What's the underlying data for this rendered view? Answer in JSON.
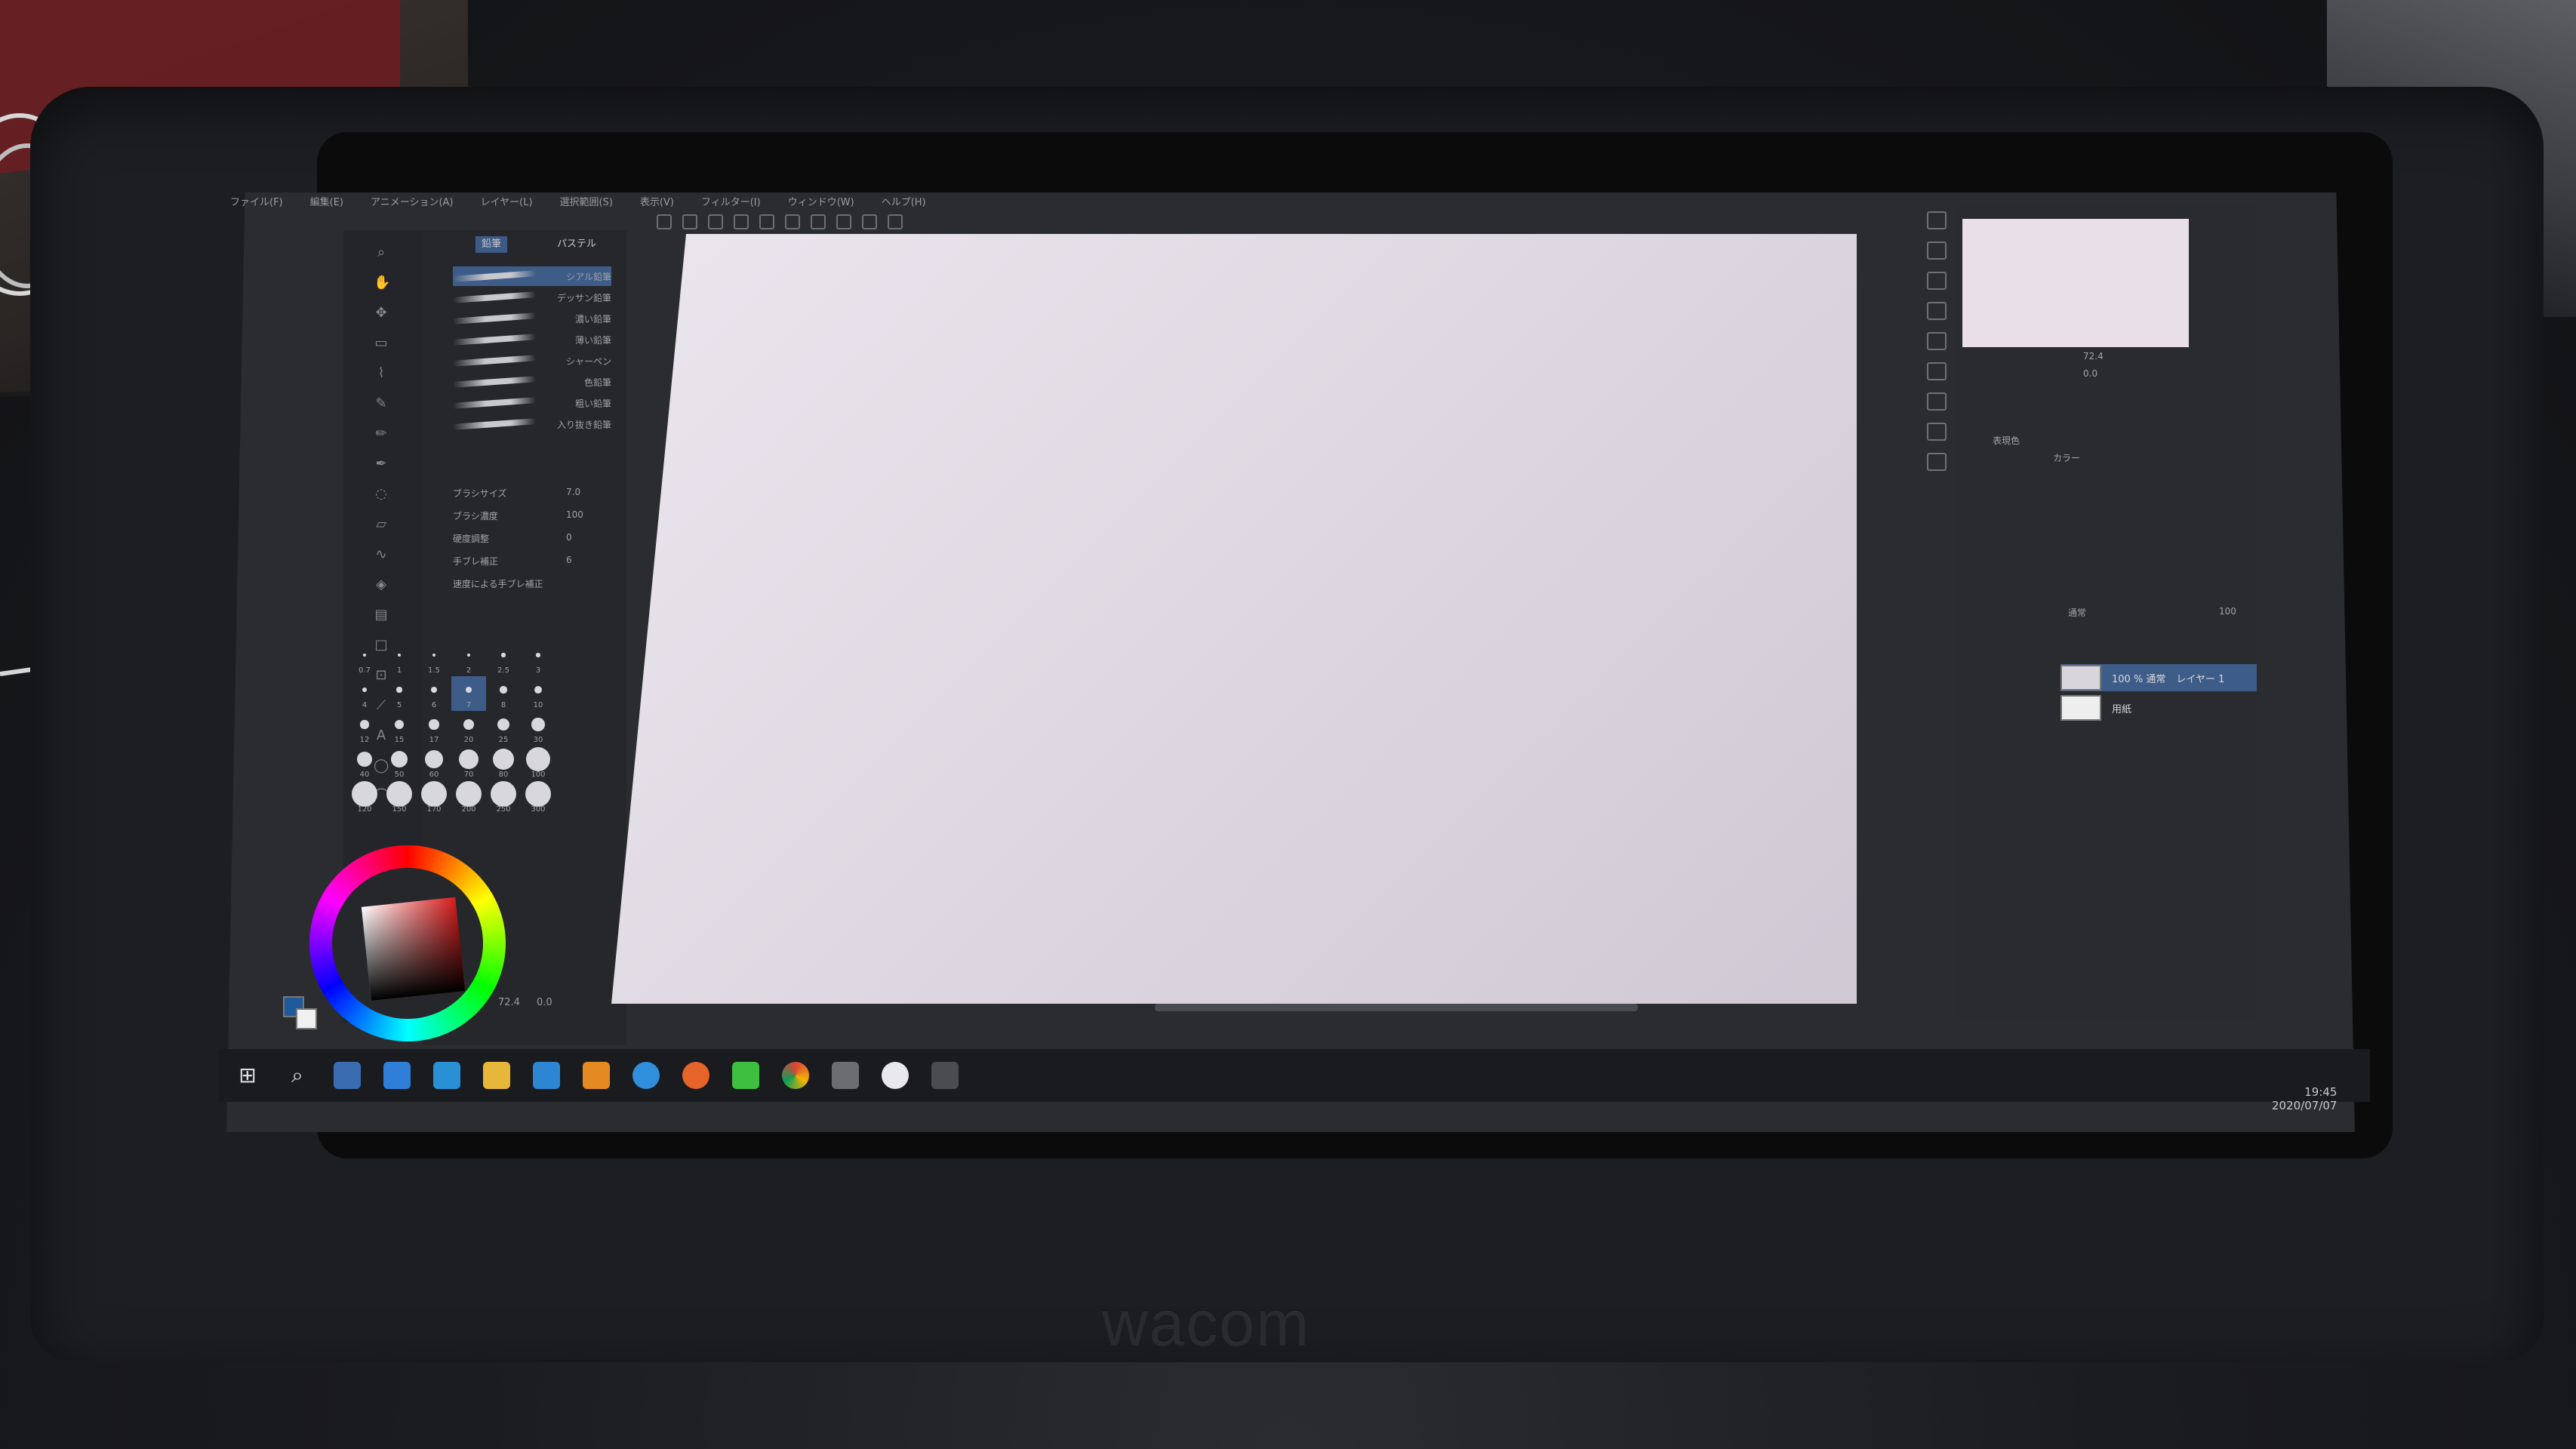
{
  "app": {
    "menu": [
      "ファイル(F)",
      "編集(E)",
      "アニメーション(A)",
      "レイヤー(L)",
      "選択範囲(S)",
      "表示(V)",
      "フィルター(I)",
      "ウィンドウ(W)",
      "ヘルプ(H)"
    ]
  },
  "subtool": {
    "tabs": [
      "鉛筆",
      "パステル"
    ],
    "brushes": [
      "シアル鉛筆",
      "デッサン鉛筆",
      "濃い鉛筆",
      "薄い鉛筆",
      "シャーペン",
      "色鉛筆",
      "粗い鉛筆",
      "入り抜き鉛筆"
    ],
    "props": {
      "brush_size_label": "ブラシサイズ",
      "brush_size_value": "7.0",
      "density_label": "ブラシ濃度",
      "density_value": "100",
      "hardness_label": "硬度調整",
      "hardness_value": "0",
      "stabilize_label": "手ブレ補正",
      "stabilize_value": "6",
      "speed_label": "速度による手ブレ補正"
    },
    "sizes": [
      "0.7",
      "1",
      "1.5",
      "2",
      "2.5",
      "3",
      "4",
      "5",
      "6",
      "7",
      "8",
      "10",
      "12",
      "15",
      "17",
      "20",
      "25",
      "30",
      "40",
      "50",
      "60",
      "70",
      "80",
      "100",
      "120",
      "150",
      "170",
      "200",
      "250",
      "300"
    ]
  },
  "statusbar": {
    "zoom": "72.4",
    "angle": "0.0"
  },
  "right": {
    "nav_zoom": "72.4",
    "nav_angle": "0.0",
    "expression_label": "表現色",
    "expression_value": "カラー",
    "layer_mode": "通常",
    "layer_opacity": "100",
    "layers": [
      {
        "name": "レイヤー 1",
        "info": "100 % 通常",
        "selected": true
      },
      {
        "name": "用紙",
        "info": "",
        "selected": false
      }
    ]
  },
  "taskbar": {
    "time": "19:45",
    "date": "2020/07/07"
  },
  "colors": {
    "accent": "#3e5c88",
    "canvas": "#e6e0e8",
    "main_color": "#d81d1d"
  },
  "brand": "wacom"
}
